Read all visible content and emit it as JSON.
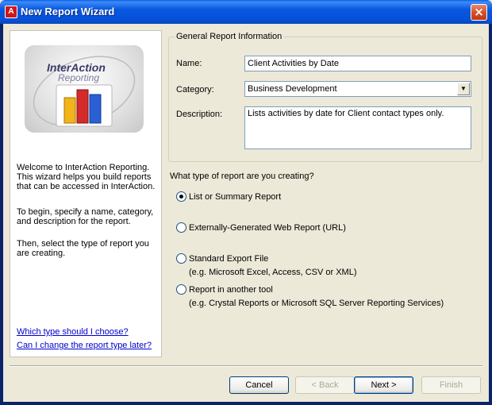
{
  "window": {
    "title": "New Report Wizard",
    "app_icon_glyph": "A",
    "close_glyph": "×"
  },
  "left_panel": {
    "logo": {
      "line1": "InterAction",
      "line2": "Reporting"
    },
    "welcome_paragraphs": [
      "Welcome to InterAction Reporting. This wizard helps you build reports that can be accessed in InterAction.",
      "To begin, specify a name, category, and description for the report.",
      "Then, select the type of report you are creating."
    ],
    "links": [
      "Which type should I choose?",
      "Can I change the report type later?"
    ]
  },
  "general_info": {
    "legend": "General Report Information",
    "name_label": "Name:",
    "name_value": "Client Activities by Date",
    "category_label": "Category:",
    "category_value": "Business Development",
    "description_label": "Description:",
    "description_value": "Lists activities by date for Client contact types only."
  },
  "report_type": {
    "question": "What type of report are you creating?",
    "options": [
      {
        "label": "List or Summary Report",
        "sub": "",
        "selected": true
      },
      {
        "label": "Externally-Generated Web Report (URL)",
        "sub": "",
        "selected": false
      },
      {
        "label": "Standard Export File",
        "sub": "(e.g. Microsoft Excel, Access, CSV or XML)",
        "selected": false
      },
      {
        "label": "Report in another tool",
        "sub": "(e.g. Crystal Reports or Microsoft SQL Server Reporting Services)",
        "selected": false
      }
    ]
  },
  "buttons": {
    "cancel": "Cancel",
    "back": "< Back",
    "next": "Next >",
    "finish": "Finish"
  },
  "colors": {
    "titlebar": "#0858E0",
    "link": "#0000CC",
    "dialog_bg": "#ECE9D8",
    "close_button": "#D4522B"
  },
  "icons": {
    "app": "interaction-app-icon",
    "close": "close-icon",
    "dropdown": "chevron-down-icon"
  }
}
